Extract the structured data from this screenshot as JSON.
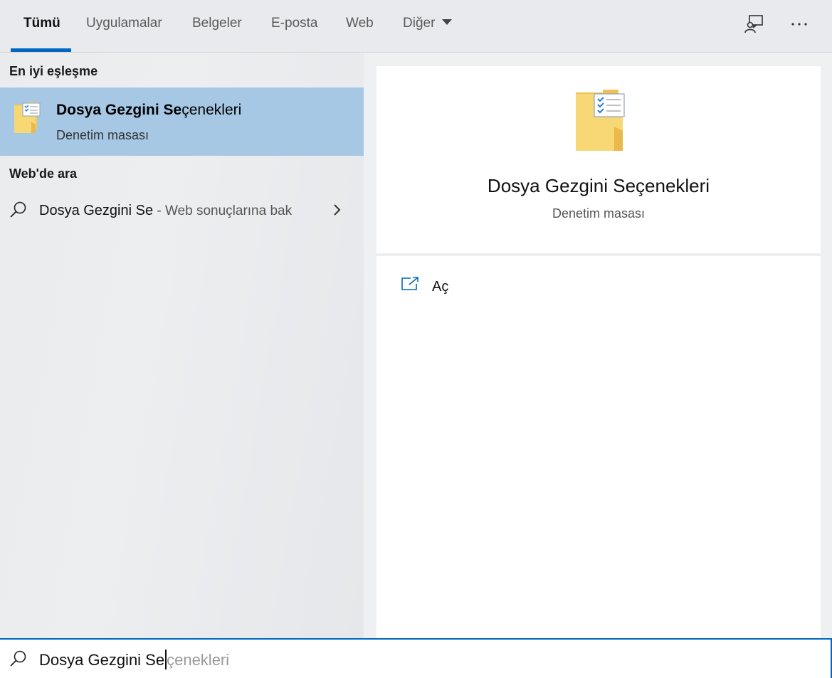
{
  "tabs": [
    {
      "label": "Tümü",
      "active": true
    },
    {
      "label": "Uygulamalar"
    },
    {
      "label": "Belgeler"
    },
    {
      "label": "E-posta"
    },
    {
      "label": "Web"
    },
    {
      "label": "Diğer"
    }
  ],
  "topbar_icons": [
    "feedback-icon",
    "more-options-icon"
  ],
  "left": {
    "best_match_heading": "En iyi eşleşme",
    "best_match": {
      "title_bold": "Dosya Gezgini Se",
      "title_rest": "çenekleri",
      "subtitle": "Denetim masası",
      "icon": "folder-options-icon"
    },
    "web_heading": "Web'de ara",
    "web_result": {
      "query": "Dosya Gezgini Se",
      "suffix": " - Web sonuçlarına bak"
    }
  },
  "right": {
    "title": "Dosya Gezgini Seçenekleri",
    "subtitle": "Denetim masası",
    "actions": [
      {
        "label": "Aç",
        "icon": "open-icon"
      }
    ]
  },
  "search": {
    "typed": "Dosya Gezgini Se",
    "completion": "çenekleri"
  },
  "colors": {
    "accent": "#0067c0",
    "highlight": "#a6c8e5",
    "folder": "#f8d775"
  }
}
